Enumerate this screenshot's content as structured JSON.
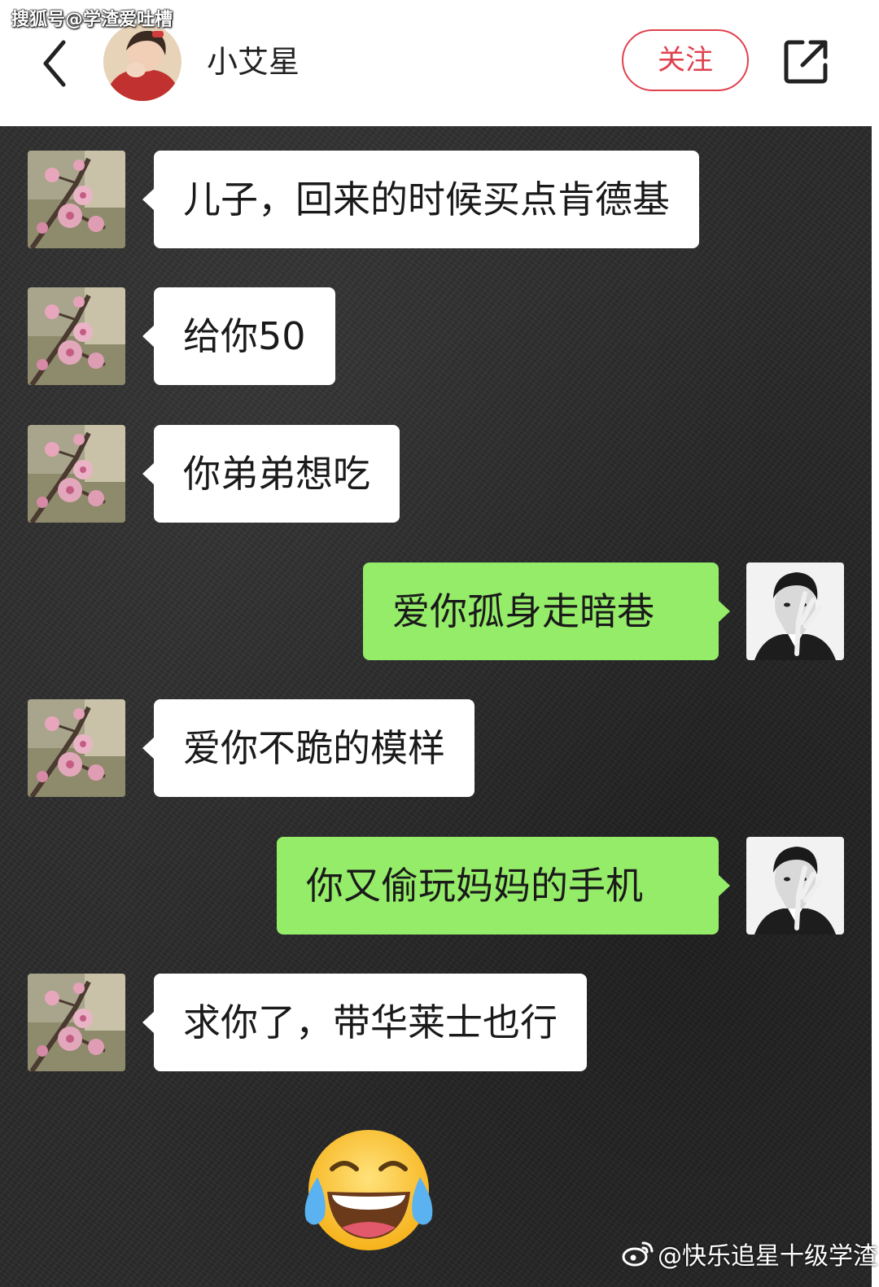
{
  "watermark_top": "搜狐号@学渣爱吐槽",
  "header": {
    "back_icon": "chevron-left-icon",
    "name": "小艾星",
    "follow_label": "关注",
    "share_icon": "share-icon",
    "accent_color": "#e0414f"
  },
  "chat": {
    "background_color": "#2a2a2a",
    "incoming_bubble_color": "#ffffff",
    "outgoing_bubble_color": "#95ec69",
    "messages": [
      {
        "side": "left",
        "text": "儿子，回来的时候买点肯德基"
      },
      {
        "side": "left",
        "text": "给你50"
      },
      {
        "side": "left",
        "text": "你弟弟想吃"
      },
      {
        "side": "right",
        "text": "爱你孤身走暗巷"
      },
      {
        "side": "left",
        "text": "爱你不跪的模样"
      },
      {
        "side": "right",
        "text": "你又偷玩妈妈的手机"
      },
      {
        "side": "left",
        "text": "求你了，带华莱士也行"
      }
    ],
    "emoji": "face-with-tears-of-joy-emoji"
  },
  "watermark_bottom": {
    "icon": "weibo-icon",
    "text": "@快乐追星十级学渣"
  }
}
